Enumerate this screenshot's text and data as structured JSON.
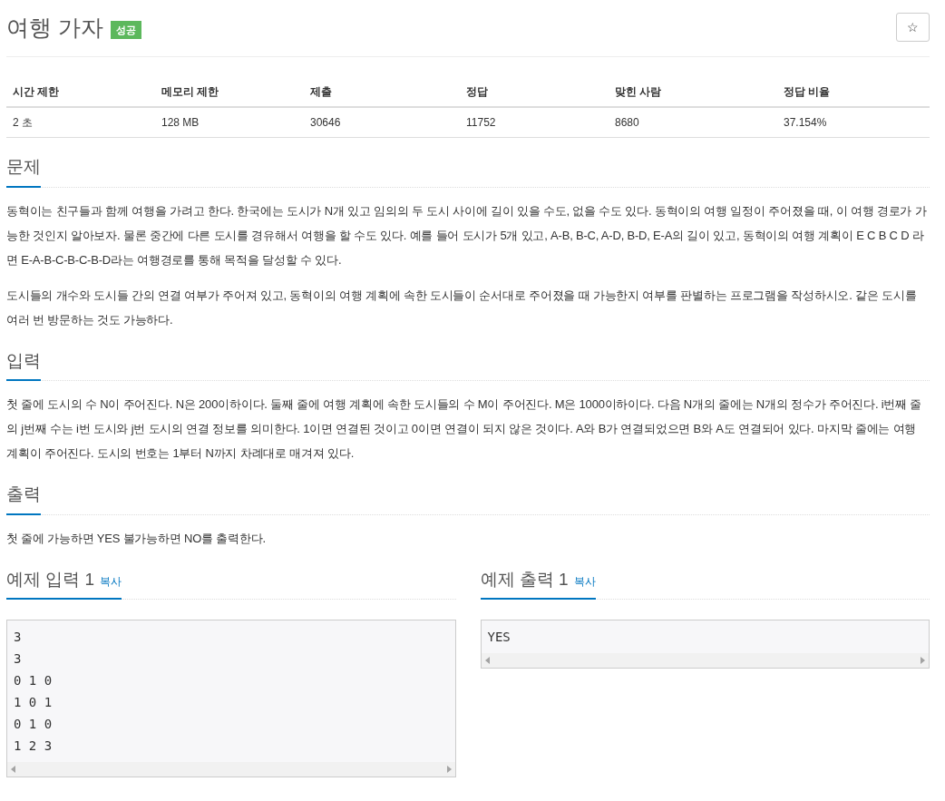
{
  "title": "여행 가자",
  "badge": {
    "label": "성공",
    "color": "#5cb85c"
  },
  "star_button": "☆",
  "info_table": {
    "columns": [
      "시간 제한",
      "메모리 제한",
      "제출",
      "정답",
      "맞힌 사람",
      "정답 비율"
    ],
    "rows": [
      [
        "2 초",
        "128 MB",
        "30646",
        "11752",
        "8680",
        "37.154%"
      ]
    ]
  },
  "sections": [
    {
      "heading": "문제",
      "paragraphs": [
        "동혁이는 친구들과 함께 여행을 가려고 한다. 한국에는 도시가 N개 있고 임의의 두 도시 사이에 길이 있을 수도, 없을 수도 있다. 동혁이의 여행 일정이 주어졌을 때, 이 여행 경로가 가능한 것인지 알아보자. 물론 중간에 다른 도시를 경유해서 여행을 할 수도 있다. 예를 들어 도시가 5개 있고, A-B, B-C, A-D, B-D, E-A의 길이 있고, 동혁이의 여행 계획이 E C B C D 라면 E-A-B-C-B-C-B-D라는 여행경로를 통해 목적을 달성할 수 있다.",
        "도시들의 개수와 도시들 간의 연결 여부가 주어져 있고, 동혁이의 여행 계획에 속한 도시들이 순서대로 주어졌을 때 가능한지 여부를 판별하는 프로그램을 작성하시오. 같은 도시를 여러 번 방문하는 것도 가능하다."
      ]
    },
    {
      "heading": "입력",
      "paragraphs": [
        "첫 줄에 도시의 수 N이 주어진다. N은 200이하이다. 둘째 줄에 여행 계획에 속한 도시들의 수 M이 주어진다. M은 1000이하이다. 다음 N개의 줄에는 N개의 정수가 주어진다. i번째 줄의 j번째 수는 i번 도시와 j번 도시의 연결 정보를 의미한다. 1이면 연결된 것이고 0이면 연결이 되지 않은 것이다. A와 B가 연결되었으면 B와 A도 연결되어 있다. 마지막 줄에는 여행 계획이 주어진다. 도시의 번호는 1부터 N까지 차례대로 매겨져 있다."
      ]
    },
    {
      "heading": "출력",
      "paragraphs": [
        "첫 줄에 가능하면 YES 불가능하면 NO를 출력한다."
      ]
    }
  ],
  "samples": [
    {
      "heading": "예제 입력 1",
      "copy": "복사",
      "lines": [
        "3",
        "3",
        "0 1 0",
        "1 0 1",
        "0 1 0",
        "1 2 3"
      ]
    },
    {
      "heading": "예제 출력 1",
      "copy": "복사",
      "lines": [
        "YES"
      ]
    }
  ]
}
